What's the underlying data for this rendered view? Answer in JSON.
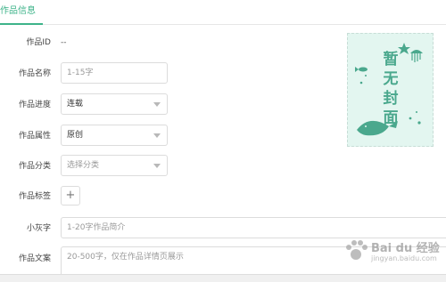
{
  "tabs": {
    "active": "作品信息"
  },
  "form": {
    "id": {
      "label": "作品ID",
      "value": "--"
    },
    "name": {
      "label": "作品名称",
      "placeholder": "1-15字"
    },
    "progress": {
      "label": "作品进度",
      "value": "连载"
    },
    "attribute": {
      "label": "作品属性",
      "value": "原创"
    },
    "category": {
      "label": "作品分类",
      "placeholder": "选择分类"
    },
    "tags": {
      "label": "作品标签",
      "add_symbol": "+"
    },
    "gray_text": {
      "label": "小灰字",
      "placeholder": "1-20字作品简介"
    },
    "copy": {
      "label": "作品文案",
      "placeholder": "20-500字，仅在作品详情页展示"
    }
  },
  "cover": {
    "text": [
      "暂",
      "无",
      "封",
      "面"
    ],
    "accent": "#4aa88d",
    "bg": "#e3f6f0"
  },
  "watermark": {
    "text": "Bai du 经验",
    "sub": "jingyan.baidu.com"
  },
  "colors": {
    "accent": "#3db389"
  }
}
